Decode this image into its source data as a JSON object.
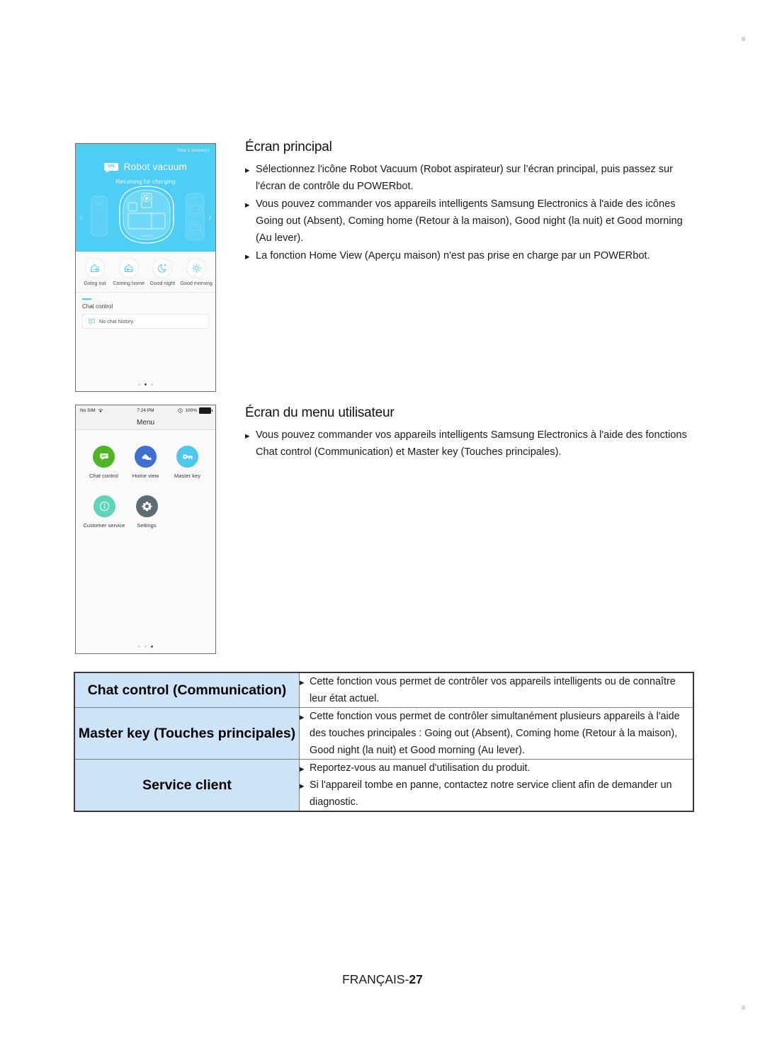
{
  "page": {
    "footer_lang": "FRANÇAIS-",
    "footer_number": "27"
  },
  "colors": {
    "hero_blue": "#4ecdf5",
    "table_header_blue": "#cde3f7",
    "chat_green": "#4cb723",
    "home_blue": "#3f6fd1",
    "key_cyan": "#4fc8ef",
    "customer_teal": "#5fd4bb",
    "settings_gray": "#5e6b72"
  },
  "phone_main": {
    "total_devices": "Total 1 device(s)",
    "power_state": "ON",
    "device_name": "Robot vacuum",
    "device_status": "Returning for charging",
    "nav_prev_icon": "chevron-left-icon",
    "nav_next_icon": "chevron-right-icon",
    "scenes": [
      {
        "label": "Going out",
        "icon": "house-arrow-out-icon"
      },
      {
        "label": "Coming home",
        "icon": "house-arrow-in-icon"
      },
      {
        "label": "Good night",
        "icon": "moon-stars-icon"
      },
      {
        "label": "Good morning",
        "icon": "sun-icon"
      }
    ],
    "chat_section_title": "Chat control",
    "chat_empty_text": "No chat history.",
    "chat_empty_icon": "speech-bubble-icon",
    "page_dots": 3,
    "active_dot": 2
  },
  "phone_menu": {
    "status_carrier": "No SIM",
    "status_wifi_icon": "wifi-icon",
    "status_time": "7:24 PM",
    "status_alarm_icon": "alarm-icon",
    "status_battery": "100%",
    "title": "Menu",
    "items": [
      {
        "label": "Chat control",
        "icon": "speech-bubble-icon",
        "color": "#4cb723"
      },
      {
        "label": "Home view",
        "icon": "home-camera-icon",
        "color": "#3f6fd1"
      },
      {
        "label": "Master key",
        "icon": "key-icon",
        "color": "#4fc8ef"
      },
      {
        "label": "Customer service",
        "icon": "info-circle-icon",
        "color": "#5fd4bb"
      },
      {
        "label": "Settings",
        "icon": "gear-icon",
        "color": "#5e6b72"
      }
    ],
    "page_dots": 3,
    "active_dot": 3
  },
  "section_main_screen": {
    "title": "Écran principal",
    "bullets": [
      "Sélectionnez l'icône Robot Vacuum (Robot aspirateur) sur l’écran principal, puis passez sur l'écran de contrôle du POWERbot.",
      "Vous pouvez commander vos appareils intelligents Samsung Electronics à l'aide des icônes Going out (Absent), Coming home (Retour à la maison), Good night (la nuit) et Good morning (Au lever).",
      "La fonction Home View (Aperçu maison) n'est pas prise en charge par un POWERbot."
    ]
  },
  "section_user_menu": {
    "title": "Écran du menu utilisateur",
    "bullets": [
      "Vous pouvez commander vos appareils intelligents Samsung Electronics à l'aide des fonctions Chat control (Communication) et Master key (Touches principales)."
    ]
  },
  "feature_table": {
    "rows": [
      {
        "label": "Chat control (Communication)",
        "bullets": [
          "Cette fonction vous permet de contrôler vos appareils intelligents ou de connaître leur état actuel."
        ]
      },
      {
        "label": "Master key (Touches principales)",
        "bullets": [
          "Cette fonction vous permet de contrôler simultanément plusieurs appareils à l'aide des touches principales : Going out (Absent), Coming home (Retour à la maison), Good night (la nuit) et Good morning (Au lever)."
        ]
      },
      {
        "label": "Service client",
        "bullets": [
          "Reportez-vous au manuel d'utilisation du produit.",
          "Si l'appareil tombe en panne, contactez notre service client afin de demander un diagnostic."
        ]
      }
    ]
  }
}
